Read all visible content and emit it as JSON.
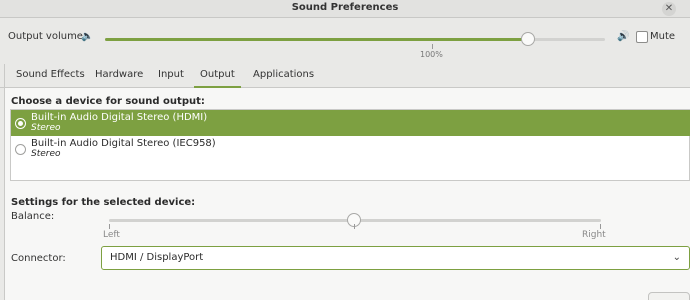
{
  "window": {
    "title": "Sound Preferences"
  },
  "volume": {
    "label": "Output volume:",
    "level_percent": 85,
    "tick_label": "100%",
    "mute_label": "Mute",
    "muted": false
  },
  "tabs": [
    {
      "label": "Sound Effects",
      "active": false
    },
    {
      "label": "Hardware",
      "active": false
    },
    {
      "label": "Input",
      "active": false
    },
    {
      "label": "Output",
      "active": true
    },
    {
      "label": "Applications",
      "active": false
    }
  ],
  "output": {
    "device_heading": "Choose a device for sound output:",
    "devices": [
      {
        "name": "Built-in Audio Digital Stereo (HDMI)",
        "profile": "Stereo",
        "selected": true
      },
      {
        "name": "Built-in Audio Digital Stereo (IEC958)",
        "profile": "Stereo",
        "selected": false
      }
    ],
    "settings_heading": "Settings for the selected device:",
    "balance": {
      "label": "Balance:",
      "left_label": "Left",
      "right_label": "Right",
      "value": 0.5
    },
    "connector": {
      "label": "Connector:",
      "value": "HDMI / DisplayPort"
    }
  },
  "colors": {
    "accent": "#7da041",
    "window_bg": "#e9e9e7",
    "panel_bg": "#f7f7f6"
  },
  "icons": {
    "close": "close-icon",
    "volume_low": "speaker-low-icon",
    "volume_high": "speaker-high-icon",
    "chevron": "chevron-down-icon"
  }
}
